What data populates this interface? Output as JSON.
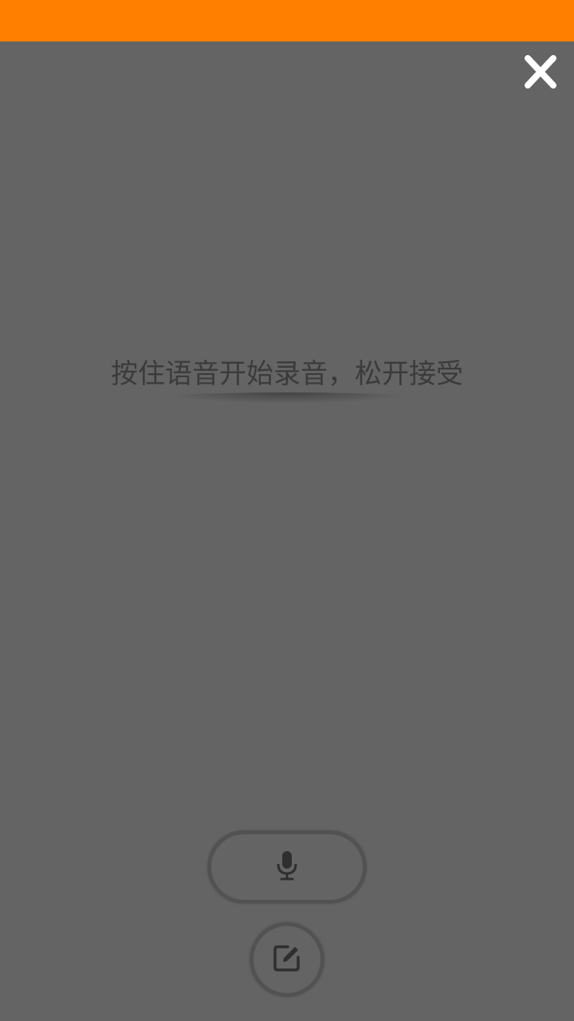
{
  "status_bar": {
    "color": "#ff7f00"
  },
  "overlay": {
    "background": "#646464",
    "close_icon": "close-icon"
  },
  "voice": {
    "hint": "按住语音开始录音，松开接受",
    "mic_icon": "microphone-icon",
    "edit_icon": "edit-icon"
  }
}
